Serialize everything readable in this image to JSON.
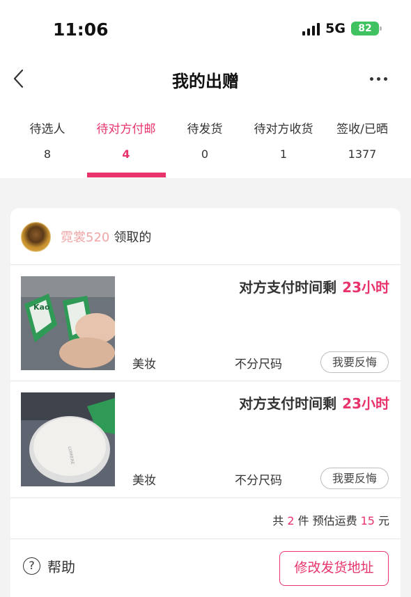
{
  "status_bar": {
    "time": "11:06",
    "network": "5G",
    "battery": "82"
  },
  "nav": {
    "title": "我的出赠",
    "back_icon": "chevron-left-icon",
    "more_icon": "more-dots-icon"
  },
  "tabs": [
    {
      "label": "待选人",
      "count": "8",
      "active": false
    },
    {
      "label": "待对方付邮",
      "count": "4",
      "active": true
    },
    {
      "label": "待发货",
      "count": "0",
      "active": false
    },
    {
      "label": "待对方收货",
      "count": "1",
      "active": false
    },
    {
      "label": "签收/已晒",
      "count": "1377",
      "active": false
    }
  ],
  "order": {
    "recipient_name": "霓裳520",
    "recipient_suffix": "领取的",
    "items": [
      {
        "timer_label": "对方支付时间剩",
        "timer_value": "23小时",
        "category": "美妆",
        "size": "不分尺码",
        "regret_label": "我要反悔"
      },
      {
        "timer_label": "对方支付时间剩",
        "timer_value": "23小时",
        "category": "美妆",
        "size": "不分尺码",
        "regret_label": "我要反悔"
      }
    ],
    "summary": {
      "prefix": "共",
      "count": "2",
      "count_unit": "件",
      "shipping_label": "预估运费",
      "shipping_value": "15",
      "shipping_unit": "元"
    },
    "help_label": "帮助",
    "address_button_label": "修改发货地址"
  },
  "colors": {
    "accent": "#e8336b",
    "recipient": "#f0a6a6",
    "battery": "#3fc25f"
  }
}
